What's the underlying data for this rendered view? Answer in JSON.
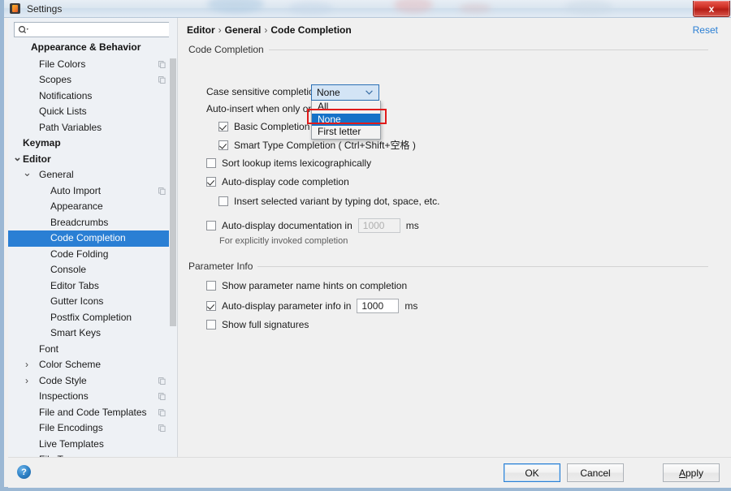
{
  "window": {
    "title": "Settings",
    "app_icon": "intellij-idea-icon",
    "close_label": "x"
  },
  "search": {
    "value": "",
    "placeholder": "",
    "icon": "search-icon"
  },
  "sidebar": {
    "sticky_header": "Appearance & Behavior",
    "items": [
      {
        "label": "Appearance & Behavior",
        "indent": 1,
        "group": true,
        "arrow": "",
        "copy": false,
        "selected": false
      },
      {
        "label": "File Colors",
        "indent": 2,
        "group": false,
        "arrow": "",
        "copy": true,
        "selected": false
      },
      {
        "label": "Scopes",
        "indent": 2,
        "group": false,
        "arrow": "",
        "copy": true,
        "selected": false
      },
      {
        "label": "Notifications",
        "indent": 2,
        "group": false,
        "arrow": "",
        "copy": false,
        "selected": false
      },
      {
        "label": "Quick Lists",
        "indent": 2,
        "group": false,
        "arrow": "",
        "copy": false,
        "selected": false
      },
      {
        "label": "Path Variables",
        "indent": 2,
        "group": false,
        "arrow": "",
        "copy": false,
        "selected": false
      },
      {
        "label": "Keymap",
        "indent": 1,
        "group": true,
        "arrow": "",
        "copy": false,
        "selected": false
      },
      {
        "label": "Editor",
        "indent": 1,
        "group": true,
        "arrow": "v",
        "copy": false,
        "selected": false
      },
      {
        "label": "General",
        "indent": 2,
        "group": false,
        "arrow": "v",
        "copy": false,
        "selected": false
      },
      {
        "label": "Auto Import",
        "indent": 3,
        "group": false,
        "arrow": "",
        "copy": true,
        "selected": false
      },
      {
        "label": "Appearance",
        "indent": 3,
        "group": false,
        "arrow": "",
        "copy": false,
        "selected": false
      },
      {
        "label": "Breadcrumbs",
        "indent": 3,
        "group": false,
        "arrow": "",
        "copy": false,
        "selected": false
      },
      {
        "label": "Code Completion",
        "indent": 3,
        "group": false,
        "arrow": "",
        "copy": false,
        "selected": true
      },
      {
        "label": "Code Folding",
        "indent": 3,
        "group": false,
        "arrow": "",
        "copy": false,
        "selected": false
      },
      {
        "label": "Console",
        "indent": 3,
        "group": false,
        "arrow": "",
        "copy": false,
        "selected": false
      },
      {
        "label": "Editor Tabs",
        "indent": 3,
        "group": false,
        "arrow": "",
        "copy": false,
        "selected": false
      },
      {
        "label": "Gutter Icons",
        "indent": 3,
        "group": false,
        "arrow": "",
        "copy": false,
        "selected": false
      },
      {
        "label": "Postfix Completion",
        "indent": 3,
        "group": false,
        "arrow": "",
        "copy": false,
        "selected": false
      },
      {
        "label": "Smart Keys",
        "indent": 3,
        "group": false,
        "arrow": "",
        "copy": false,
        "selected": false
      },
      {
        "label": "Font",
        "indent": 2,
        "group": false,
        "arrow": "",
        "copy": false,
        "selected": false
      },
      {
        "label": "Color Scheme",
        "indent": 2,
        "group": false,
        "arrow": ">",
        "copy": false,
        "selected": false
      },
      {
        "label": "Code Style",
        "indent": 2,
        "group": false,
        "arrow": ">",
        "copy": true,
        "selected": false
      },
      {
        "label": "Inspections",
        "indent": 2,
        "group": false,
        "arrow": "",
        "copy": true,
        "selected": false
      },
      {
        "label": "File and Code Templates",
        "indent": 2,
        "group": false,
        "arrow": "",
        "copy": true,
        "selected": false
      },
      {
        "label": "File Encodings",
        "indent": 2,
        "group": false,
        "arrow": "",
        "copy": true,
        "selected": false
      },
      {
        "label": "Live Templates",
        "indent": 2,
        "group": false,
        "arrow": "",
        "copy": false,
        "selected": false
      },
      {
        "label": "File Types",
        "indent": 2,
        "group": false,
        "arrow": "",
        "copy": false,
        "selected": false
      }
    ]
  },
  "breadcrumb": {
    "part1": "Editor",
    "sep": "›",
    "part2": "General",
    "part3": "Code Completion"
  },
  "reset_label": "Reset",
  "code_completion": {
    "section_title": "Code Completion",
    "case_sensitive_label": "Case sensitive completion:",
    "case_sensitive_value": "None",
    "dropdown_options": [
      "All",
      "None",
      "First letter"
    ],
    "dropdown_selected": "None",
    "auto_insert_label": "Auto-insert when only one",
    "basic_completion_label": "Basic Completion ( Ctrl+空格 )",
    "basic_completion_checked": true,
    "smart_type_label": "Smart Type Completion ( Ctrl+Shift+空格 )",
    "smart_type_checked": true,
    "sort_lookup_label": "Sort lookup items lexicographically",
    "sort_lookup_checked": false,
    "auto_display_label": "Auto-display code completion",
    "auto_display_checked": true,
    "insert_variant_label": "Insert selected variant by typing dot, space, etc.",
    "insert_variant_checked": false,
    "auto_doc_label": "Auto-display documentation in",
    "auto_doc_checked": false,
    "auto_doc_value": "1000",
    "auto_doc_unit": "ms",
    "auto_doc_hint": "For explicitly invoked completion"
  },
  "parameter_info": {
    "section_title": "Parameter Info",
    "show_hints_label": "Show parameter name hints on completion",
    "show_hints_checked": false,
    "auto_display_label": "Auto-display parameter info in",
    "auto_display_checked": true,
    "auto_display_value": "1000",
    "auto_display_unit": "ms",
    "show_signatures_label": "Show full signatures",
    "show_signatures_checked": false
  },
  "footer": {
    "help_icon": "?",
    "ok_label": "OK",
    "cancel_label": "Cancel",
    "apply_label_accent": "A",
    "apply_label_rest": "pply"
  },
  "colors": {
    "accent_blue": "#2a7fd4",
    "selection_blue": "#1572c8",
    "highlight_red": "#e01b1b",
    "pane_bg": "#f0f0f0",
    "tree_bg": "#eef1f5"
  }
}
